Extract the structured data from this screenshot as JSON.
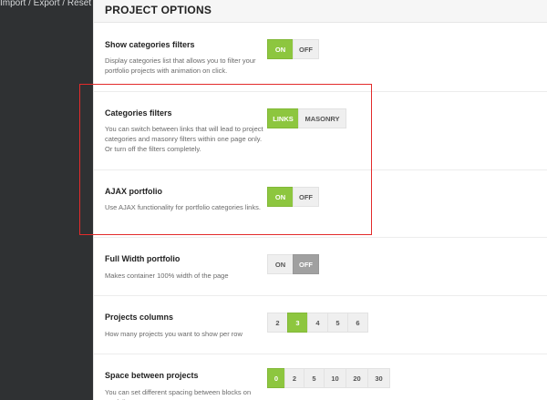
{
  "sidebar": {
    "items": [
      {
        "label": "Import / Export / Reset"
      }
    ]
  },
  "header": {
    "title": "PROJECT OPTIONS"
  },
  "options": [
    {
      "title": "Show categories filters",
      "description": "Display categories list that allows you to filter your portfolio projects with animation on click.",
      "buttons": [
        "ON",
        "OFF"
      ],
      "selected": "ON"
    },
    {
      "title": "Categories filters",
      "description": "You can switch between links that will lead to project categories and masonry filters within one page only. Or turn off the filters completely.",
      "buttons": [
        "LINKS",
        "MASONRY"
      ],
      "selected": "LINKS"
    },
    {
      "title": "AJAX portfolio",
      "description": "Use AJAX functionality for portfolio categories links.",
      "buttons": [
        "ON",
        "OFF"
      ],
      "selected": "ON"
    },
    {
      "title": "Full Width portfolio",
      "description": "Makes container 100% width of the page",
      "buttons": [
        "ON",
        "OFF"
      ],
      "selected": "OFF"
    },
    {
      "title": "Projects columns",
      "description": "How many projects you want to show per row",
      "buttons": [
        "2",
        "3",
        "4",
        "5",
        "6"
      ],
      "selected": "3"
    },
    {
      "title": "Space between projects",
      "description": "You can set different spacing between blocks on portfolio page",
      "buttons": [
        "0",
        "2",
        "5",
        "10",
        "20",
        "30"
      ],
      "selected": "0"
    }
  ],
  "colors": {
    "active_green": "#8dc63f",
    "active_gray": "#a0a0a0",
    "highlight_red": "#e32b2b",
    "sidebar_bg": "#2f3133"
  }
}
